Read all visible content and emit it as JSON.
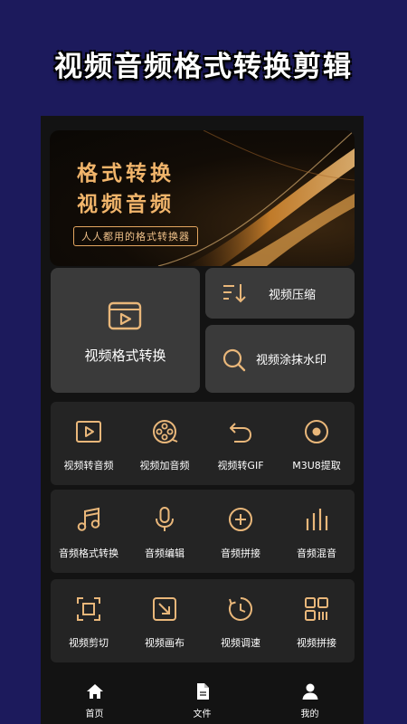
{
  "headline": "视频音频格式转换剪辑",
  "banner": {
    "title_line1": "格式转换",
    "title_line2": "视频音频",
    "subtitle": "人人都用的格式转换器"
  },
  "feature_cards": {
    "video_format_convert": "视频格式转换",
    "video_compress": "视频压缩",
    "video_watermark": "视频涂抹水印"
  },
  "grid": {
    "row1": [
      {
        "label": "视频转音频",
        "icon": "play-square-icon"
      },
      {
        "label": "视频加音频",
        "icon": "film-reel-icon"
      },
      {
        "label": "视频转GIF",
        "icon": "undo-arrow-icon"
      },
      {
        "label": "M3U8提取",
        "icon": "disc-icon"
      }
    ],
    "row2": [
      {
        "label": "音频格式转换",
        "icon": "music-note-icon"
      },
      {
        "label": "音频编辑",
        "icon": "microphone-icon"
      },
      {
        "label": "音频拼接",
        "icon": "plus-circle-icon"
      },
      {
        "label": "音频混音",
        "icon": "equalizer-icon"
      }
    ],
    "row3": [
      {
        "label": "视频剪切",
        "icon": "crop-frame-icon"
      },
      {
        "label": "视频画布",
        "icon": "resize-arrow-icon"
      },
      {
        "label": "视频调速",
        "icon": "speed-clock-icon"
      },
      {
        "label": "视频拼接",
        "icon": "qr-grid-icon"
      }
    ]
  },
  "tabs": [
    {
      "label": "首页",
      "icon": "home-icon"
    },
    {
      "label": "文件",
      "icon": "file-icon"
    },
    {
      "label": "我的",
      "icon": "user-icon"
    }
  ],
  "colors": {
    "background": "#1c1a5c",
    "accent": "#e9b77a",
    "card": "#3a3a3a",
    "grid_card": "#242424"
  }
}
